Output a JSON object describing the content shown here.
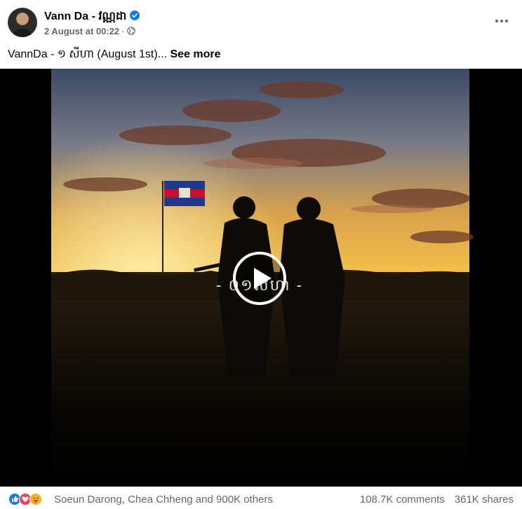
{
  "post": {
    "author_name": "Vann Da - វណ្ណដា",
    "timestamp": "2 August at 00:22",
    "separator": "·",
    "caption": "VannDa - ១ សីហា (August 1st)...",
    "see_more_label": "See more",
    "verified_icon": "verified-badge-icon",
    "privacy_icon": "globe-icon"
  },
  "video": {
    "overlay_text": "- ០១សីហា -",
    "play_icon": "play-icon"
  },
  "engagement": {
    "reacted_by": "Soeun Darong, Chea Chheng and 900K others",
    "comments": "108.7K comments",
    "shares": "361K shares",
    "reaction_icons": [
      "like-icon",
      "love-icon",
      "care-icon"
    ]
  },
  "colors": {
    "verified": "#1877f2",
    "secondary_text": "#65676b",
    "like": "#1877f2",
    "love": "#f33e58",
    "care": "#f7b125"
  }
}
